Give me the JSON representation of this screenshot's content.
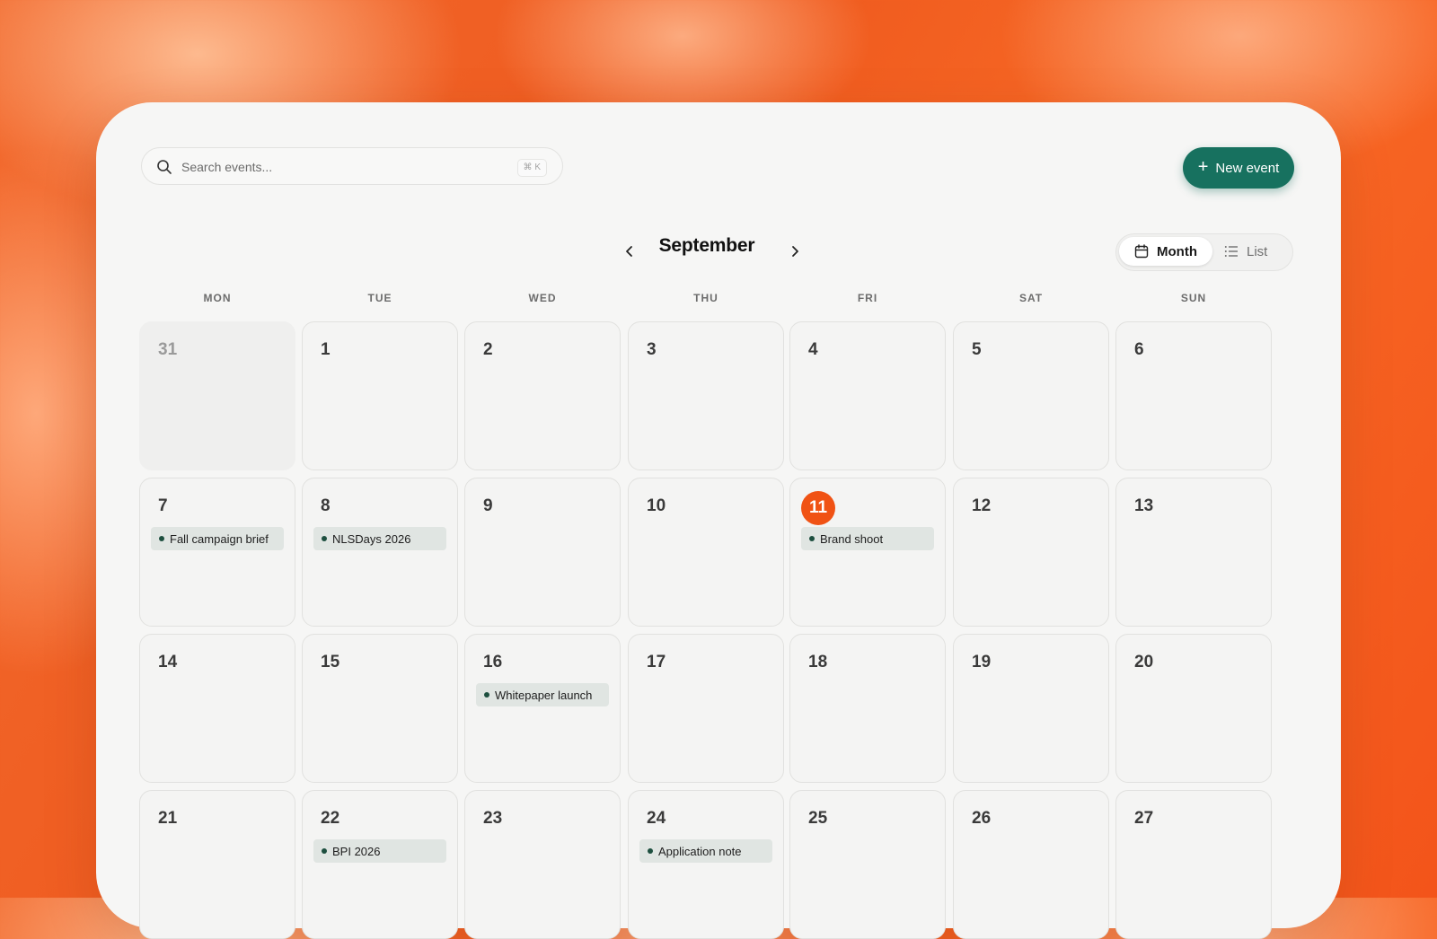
{
  "search": {
    "placeholder": "Search events...",
    "shortcut": "⌘ K"
  },
  "toolbar": {
    "new_event_label": "New event"
  },
  "calendar": {
    "month": "September",
    "views": {
      "month_label": "Month",
      "list_label": "List"
    },
    "weekdays": [
      "MON",
      "TUE",
      "WED",
      "THU",
      "FRI",
      "SAT",
      "SUN"
    ],
    "today": "11",
    "weeks": [
      [
        {
          "day": "31",
          "outside_month": true
        },
        {
          "day": "1"
        },
        {
          "day": "2"
        },
        {
          "day": "3"
        },
        {
          "day": "4"
        },
        {
          "day": "5"
        },
        {
          "day": "6"
        }
      ],
      [
        {
          "day": "7",
          "event": "Fall campaign brief"
        },
        {
          "day": "8",
          "event": "NLSDays 2026"
        },
        {
          "day": "9"
        },
        {
          "day": "10"
        },
        {
          "day": "11",
          "event": "Brand shoot"
        },
        {
          "day": "12"
        },
        {
          "day": "13"
        }
      ],
      [
        {
          "day": "14"
        },
        {
          "day": "15"
        },
        {
          "day": "16",
          "event": "Whitepaper launch"
        },
        {
          "day": "17"
        },
        {
          "day": "18"
        },
        {
          "day": "19"
        },
        {
          "day": "20"
        }
      ],
      [
        {
          "day": "21"
        },
        {
          "day": "22",
          "event": "BPI 2026"
        },
        {
          "day": "23"
        },
        {
          "day": "24",
          "event": "Application note"
        },
        {
          "day": "25"
        },
        {
          "day": "26"
        },
        {
          "day": "27"
        }
      ]
    ]
  },
  "colors": {
    "accent": "#17715f",
    "today": "#f05214",
    "event_bg": "#e0e5e2",
    "event_dot": "#1d4f3f"
  }
}
